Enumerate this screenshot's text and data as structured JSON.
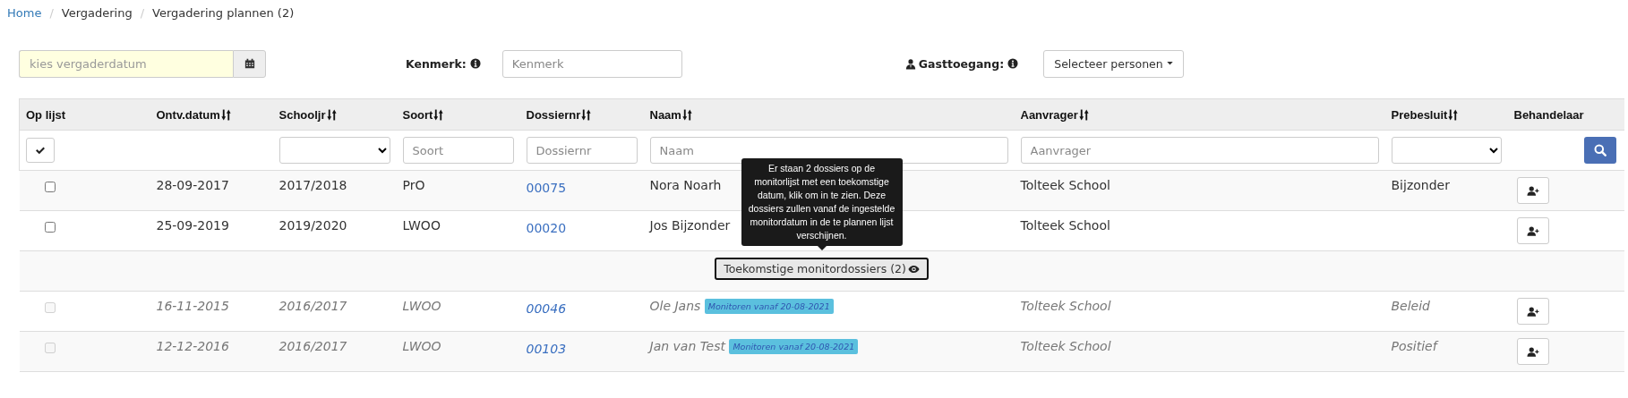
{
  "breadcrumb_separator": "/",
  "breadcrumb": [
    {
      "label": "Home",
      "link": true
    },
    {
      "label": "Vergadering",
      "link": false
    },
    {
      "label": "Vergadering plannen (2)",
      "link": false
    }
  ],
  "toolbar": {
    "date_field": {
      "placeholder": "kies vergaderdatum"
    },
    "kenmerk": {
      "label": "Kenmerk:",
      "placeholder": "Kenmerk"
    },
    "gasttoegang": {
      "label": "Gasttoegang:",
      "button": "Selecteer personen"
    }
  },
  "table": {
    "columns": [
      {
        "label": "Op lijst",
        "sortable": false,
        "filter": {
          "kind": "check-all"
        }
      },
      {
        "label": "Ontv.datum",
        "sortable": true,
        "filter": {
          "kind": "none"
        }
      },
      {
        "label": "Schooljr",
        "sortable": true,
        "filter": {
          "kind": "select"
        }
      },
      {
        "label": "Soort",
        "sortable": true,
        "filter": {
          "kind": "text",
          "placeholder": "Soort"
        }
      },
      {
        "label": "Dossiernr",
        "sortable": true,
        "filter": {
          "kind": "text",
          "placeholder": "Dossiernr"
        }
      },
      {
        "label": "Naam",
        "sortable": true,
        "filter": {
          "kind": "text",
          "placeholder": "Naam"
        }
      },
      {
        "label": "Aanvrager",
        "sortable": true,
        "filter": {
          "kind": "text",
          "placeholder": "Aanvrager"
        }
      },
      {
        "label": "Prebesluit",
        "sortable": true,
        "filter": {
          "kind": "select"
        }
      },
      {
        "label": "Behandelaar",
        "sortable": false,
        "filter": {
          "kind": "search-button"
        }
      }
    ],
    "rows": [
      {
        "checked": false,
        "future": false,
        "ontv": "28-09-2017",
        "schooljaar": "2017/2018",
        "soort": "PrO",
        "dossiernr": "00075",
        "naam": "Nora Noarh",
        "aanvrager": "Tolteek School",
        "prebesluit": "Bijzonder"
      },
      {
        "checked": false,
        "future": false,
        "ontv": "25-09-2019",
        "schooljaar": "2019/2020",
        "soort": "LWOO",
        "dossiernr": "00020",
        "naam": "Jos Bijzonder",
        "aanvrager": "Tolteek School"
      }
    ],
    "monitor_toggle": {
      "label": "Toekomstige monitordossiers (2)",
      "tooltip": "Er staan 2 dossiers op de monitorlijst met een toekomstige datum, klik om in te zien. Deze dossiers zullen vanaf de ingestelde monitordatum in de te plannen lijst verschijnen."
    },
    "future_rows": [
      {
        "checked": false,
        "future": true,
        "ontv": "16-11-2015",
        "schooljaar": "2016/2017",
        "soort": "LWOO",
        "dossiernr": "00046",
        "naam": "Ole Jans",
        "badge": "Monitoren vanaf 20-08-2021",
        "aanvrager": "Tolteek School",
        "prebesluit": "Beleid"
      },
      {
        "checked": false,
        "future": true,
        "ontv": "12-12-2016",
        "schooljaar": "2016/2017",
        "soort": "LWOO",
        "dossiernr": "00103",
        "naam": "Jan van Test",
        "badge": "Monitoren vanaf 20-08-2021",
        "aanvrager": "Tolteek School",
        "prebesluit": "Positief"
      }
    ]
  }
}
